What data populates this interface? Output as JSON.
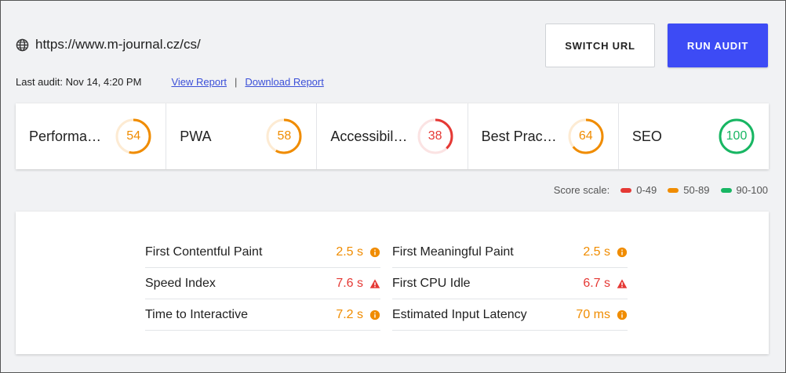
{
  "header": {
    "url": "https://www.m-journal.cz/cs/",
    "last_audit": "Last audit: Nov 14, 4:20 PM",
    "view_report": "View Report",
    "separator": "|",
    "download_report": "Download Report",
    "switch_url_label": "SWITCH URL",
    "run_audit_label": "RUN AUDIT"
  },
  "scores": [
    {
      "label": "Performan…",
      "value": "54",
      "fraction": 0.54,
      "status": "average"
    },
    {
      "label": "PWA",
      "value": "58",
      "fraction": 0.58,
      "status": "average"
    },
    {
      "label": "Accessibil…",
      "value": "38",
      "fraction": 0.38,
      "status": "fail"
    },
    {
      "label": "Best Pract…",
      "value": "64",
      "fraction": 0.64,
      "status": "average"
    },
    {
      "label": "SEO",
      "value": "100",
      "fraction": 1.0,
      "status": "pass"
    }
  ],
  "scale": {
    "label": "Score scale:",
    "fail": "0-49",
    "average": "50-89",
    "pass": "90-100"
  },
  "metrics": {
    "left": [
      {
        "name": "First Contentful Paint",
        "value": "2.5 s",
        "status": "average",
        "icon": "info-icon"
      },
      {
        "name": "Speed Index",
        "value": "7.6 s",
        "status": "fail",
        "icon": "warning-icon"
      },
      {
        "name": "Time to Interactive",
        "value": "7.2 s",
        "status": "average",
        "icon": "info-icon"
      }
    ],
    "right": [
      {
        "name": "First Meaningful Paint",
        "value": "2.5 s",
        "status": "average",
        "icon": "info-icon"
      },
      {
        "name": "First CPU Idle",
        "value": "6.7 s",
        "status": "fail",
        "icon": "warning-icon"
      },
      {
        "name": "Estimated Input Latency",
        "value": "70 ms",
        "status": "average",
        "icon": "info-icon"
      }
    ]
  },
  "colors": {
    "fail": "#e53935",
    "average": "#f08c00",
    "pass": "#18b663",
    "accent": "#3d4bf5"
  }
}
